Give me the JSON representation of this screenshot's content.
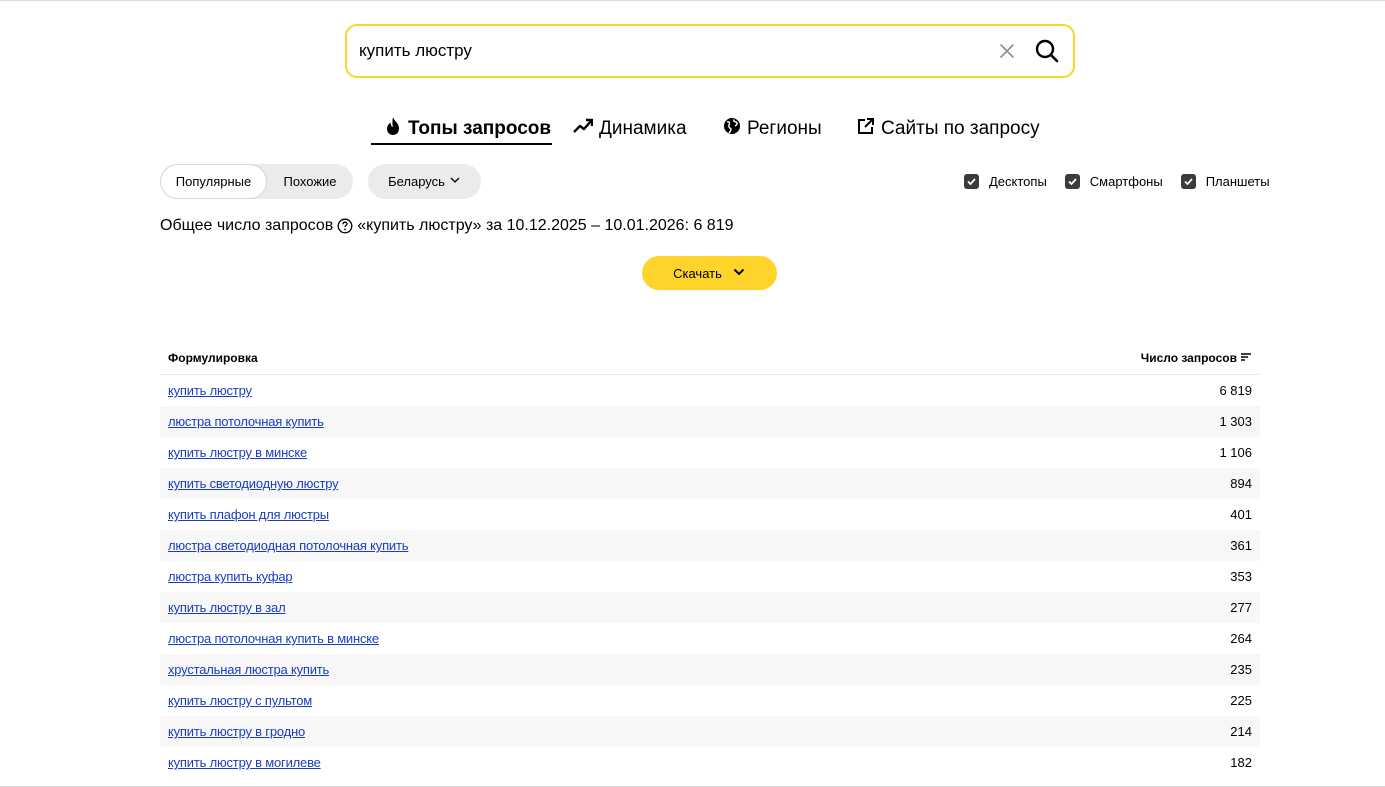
{
  "search": {
    "value": "купить люстру"
  },
  "tabs": [
    {
      "label": "Топы запросов",
      "icon": "fire-icon",
      "active": true
    },
    {
      "label": "Динамика",
      "icon": "trend-icon",
      "active": false
    },
    {
      "label": "Регионы",
      "icon": "globe-icon",
      "active": false
    },
    {
      "label": "Сайты по запросу",
      "icon": "external-link-icon",
      "active": false
    }
  ],
  "filters": {
    "mode_options": [
      "Популярные",
      "Похожие"
    ],
    "mode_selected": "Популярные",
    "region": "Беларусь",
    "devices": [
      {
        "label": "Десктопы",
        "checked": true
      },
      {
        "label": "Смартфоны",
        "checked": true
      },
      {
        "label": "Планшеты",
        "checked": true
      }
    ]
  },
  "summary": {
    "prefix": "Общее число запросов",
    "suffix": "«купить люстру» за 10.12.2025 – 10.01.2026: 6 819"
  },
  "download_label": "Скачать",
  "table": {
    "col_phrase": "Формулировка",
    "col_count": "Число запросов",
    "rows": [
      {
        "phrase": "купить люстру",
        "count": "6 819"
      },
      {
        "phrase": "люстра потолочная купить",
        "count": "1 303"
      },
      {
        "phrase": "купить люстру в минске",
        "count": "1 106"
      },
      {
        "phrase": "купить светодиодную люстру",
        "count": "894"
      },
      {
        "phrase": "купить плафон для люстры",
        "count": "401"
      },
      {
        "phrase": "люстра светодиодная потолочная купить",
        "count": "361"
      },
      {
        "phrase": "люстра купить куфар",
        "count": "353"
      },
      {
        "phrase": "купить люстру в зал",
        "count": "277"
      },
      {
        "phrase": "люстра потолочная купить в минске",
        "count": "264"
      },
      {
        "phrase": "хрустальная люстра купить",
        "count": "235"
      },
      {
        "phrase": "купить люстру с пультом",
        "count": "225"
      },
      {
        "phrase": "купить люстру в гродно",
        "count": "214"
      },
      {
        "phrase": "купить люстру в могилеве",
        "count": "182"
      }
    ]
  },
  "colors": {
    "accent_yellow": "#fed42b",
    "link": "#1a3dc1"
  }
}
